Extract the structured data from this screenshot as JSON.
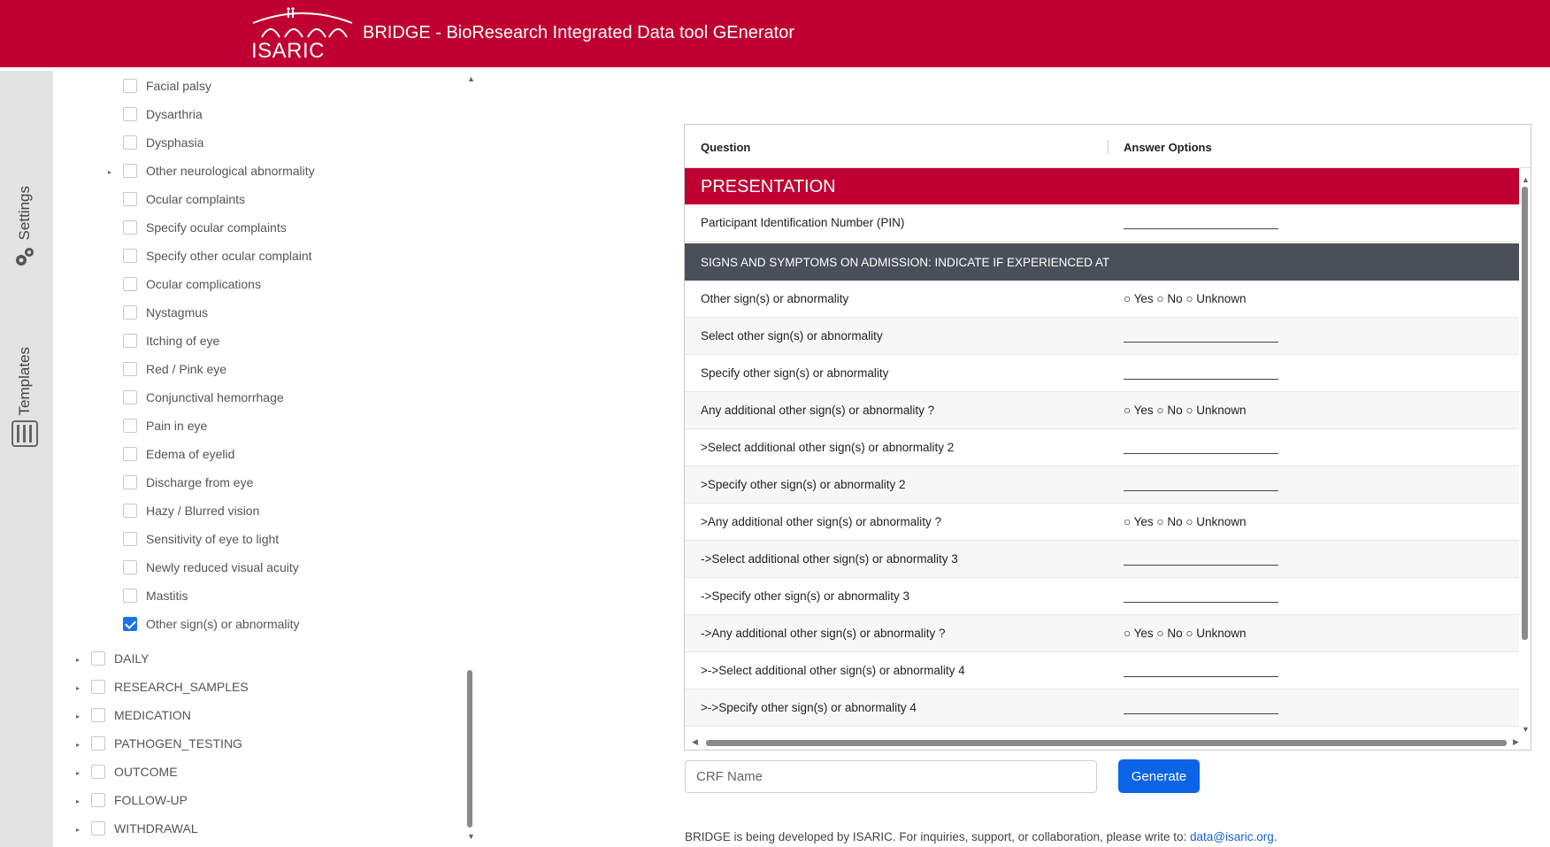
{
  "header": {
    "logo_text": "ISARIC",
    "title": "BRIDGE - BioResearch Integrated Data tool GEnerator"
  },
  "side_rail": {
    "settings_label": "Settings",
    "templates_label": "Templates"
  },
  "tree": {
    "children": [
      {
        "label": "Facial palsy",
        "checked": false,
        "expandable": false
      },
      {
        "label": "Dysarthria",
        "checked": false,
        "expandable": false
      },
      {
        "label": "Dysphasia",
        "checked": false,
        "expandable": false
      },
      {
        "label": "Other neurological abnormality",
        "checked": false,
        "expandable": true
      },
      {
        "label": "Ocular complaints",
        "checked": false,
        "expandable": false
      },
      {
        "label": "Specify ocular complaints",
        "checked": false,
        "expandable": false
      },
      {
        "label": "Specify other ocular complaint",
        "checked": false,
        "expandable": false
      },
      {
        "label": "Ocular complications",
        "checked": false,
        "expandable": false
      },
      {
        "label": "Nystagmus",
        "checked": false,
        "expandable": false
      },
      {
        "label": "Itching of eye",
        "checked": false,
        "expandable": false
      },
      {
        "label": "Red / Pink eye",
        "checked": false,
        "expandable": false
      },
      {
        "label": "Conjunctival hemorrhage",
        "checked": false,
        "expandable": false
      },
      {
        "label": "Pain in eye",
        "checked": false,
        "expandable": false
      },
      {
        "label": "Edema of eyelid",
        "checked": false,
        "expandable": false
      },
      {
        "label": "Discharge from eye",
        "checked": false,
        "expandable": false
      },
      {
        "label": "Hazy / Blurred vision",
        "checked": false,
        "expandable": false
      },
      {
        "label": "Sensitivity of eye to light",
        "checked": false,
        "expandable": false
      },
      {
        "label": "Newly reduced visual acuity",
        "checked": false,
        "expandable": false
      },
      {
        "label": "Mastitis",
        "checked": false,
        "expandable": false
      },
      {
        "label": "Other sign(s) or abnormality",
        "checked": true,
        "expandable": false
      }
    ],
    "sections": [
      {
        "label": "DAILY",
        "checked": false
      },
      {
        "label": "RESEARCH_SAMPLES",
        "checked": false
      },
      {
        "label": "MEDICATION",
        "checked": false
      },
      {
        "label": "PATHOGEN_TESTING",
        "checked": false
      },
      {
        "label": "OUTCOME",
        "checked": false
      },
      {
        "label": "FOLLOW-UP",
        "checked": false
      },
      {
        "label": "WITHDRAWAL",
        "checked": false
      }
    ]
  },
  "table": {
    "col_question": "Question",
    "col_answer": "Answer Options",
    "section_title": "PRESENTATION",
    "subsection_title": "SIGNS AND SYMPTOMS ON ADMISSION: INDICATE IF EXPERIENCED AT",
    "first_row": {
      "question": "Participant Identification Number (PIN)",
      "type": "blank"
    },
    "rows": [
      {
        "question": "Other sign(s) or abnormality",
        "type": "radio",
        "answer": "○ Yes ○ No ○ Unknown"
      },
      {
        "question": "Select other sign(s) or abnormality",
        "type": "blank"
      },
      {
        "question": "Specify other sign(s) or abnormality",
        "type": "blank"
      },
      {
        "question": "Any additional other sign(s) or abnormality ?",
        "type": "radio",
        "answer": "○ Yes ○ No ○ Unknown"
      },
      {
        "question": ">Select additional other sign(s) or abnormality 2",
        "type": "blank"
      },
      {
        "question": ">Specify other sign(s) or abnormality 2",
        "type": "blank"
      },
      {
        "question": ">Any additional other sign(s) or abnormality ?",
        "type": "radio",
        "answer": "○ Yes ○ No ○ Unknown"
      },
      {
        "question": "->Select additional other sign(s) or abnormality 3",
        "type": "blank"
      },
      {
        "question": "->Specify other sign(s) or abnormality 3",
        "type": "blank"
      },
      {
        "question": "->Any additional other sign(s) or abnormality ?",
        "type": "radio",
        "answer": "○ Yes ○ No ○ Unknown"
      },
      {
        "question": ">->Select additional other sign(s) or abnormality 4",
        "type": "blank"
      },
      {
        "question": ">->Specify other sign(s) or abnormality 4",
        "type": "blank"
      }
    ]
  },
  "form": {
    "crf_name_placeholder": "CRF Name",
    "crf_name_value": "",
    "generate_label": "Generate"
  },
  "footer": {
    "text": "BRIDGE is being developed by ISARIC. For inquiries, support, or collaboration, please write to: ",
    "email": "data@isaric.org",
    "suffix": "."
  },
  "colors": {
    "brand_red": "#bf0030",
    "subsection_gray": "#4a4f59",
    "primary_blue": "#0b63e5"
  }
}
